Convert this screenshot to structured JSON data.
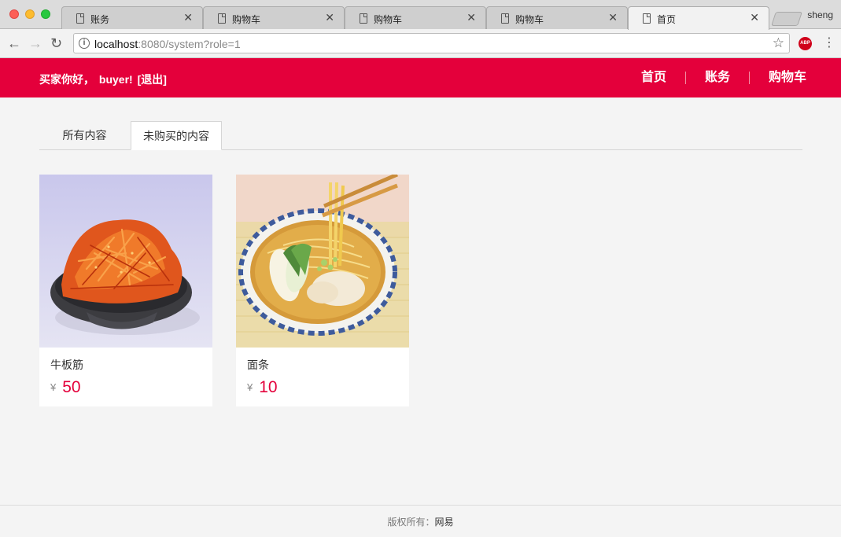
{
  "browser": {
    "tabs": [
      {
        "label": "账务",
        "active": false
      },
      {
        "label": "购物车",
        "active": false
      },
      {
        "label": "购物车",
        "active": false
      },
      {
        "label": "购物车",
        "active": false
      },
      {
        "label": "首页",
        "active": true
      }
    ],
    "tab_close_glyph": "✕",
    "profile": "sheng",
    "url_host": "localhost",
    "url_rest": ":8080/system?role=1",
    "extension": "ABP",
    "icons": [
      "back-icon",
      "forward-icon",
      "reload-icon",
      "info-icon",
      "star-icon",
      "menu-icon",
      "document-icon"
    ]
  },
  "header": {
    "greeting_prefix": "买家你好，",
    "username": "buyer!",
    "logout": "[退出]",
    "nav": [
      "首页",
      "账务",
      "购物车"
    ],
    "color": "#e4003b"
  },
  "filter_tabs": {
    "all": "所有内容",
    "unbought": "未购买的内容",
    "selected": "unbought"
  },
  "products": [
    {
      "name": "牛板筋",
      "currency": "¥",
      "price": "50"
    },
    {
      "name": "面条",
      "currency": "¥",
      "price": "10"
    }
  ],
  "footer": {
    "label": "版权所有：",
    "brand": "网易"
  }
}
